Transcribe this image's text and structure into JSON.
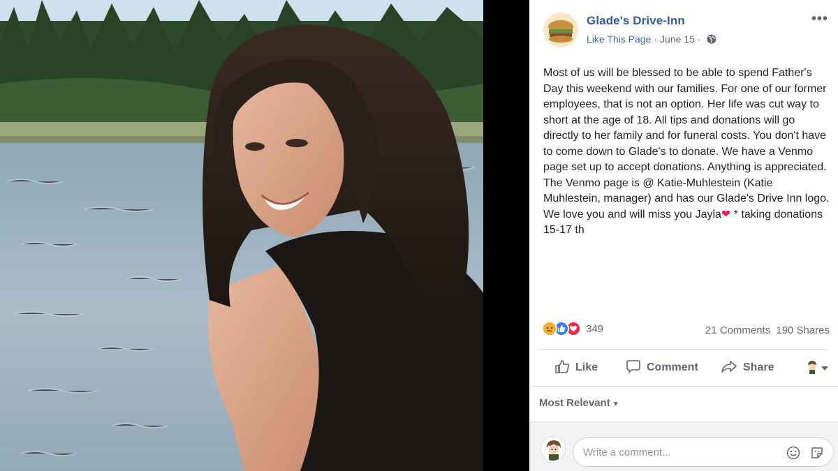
{
  "post": {
    "page_name": "Glade's Drive-Inn",
    "like_page": "Like This Page",
    "date": "June 15",
    "separator": "·",
    "more": "•••",
    "text_parts": [
      "Most of us will be blessed to be able to spend Father's Day this weekend with our families. For one of our former employees, that is not an option. Her life was cut way to short at the age of 18. All tips and donations will go directly to her family and for funeral costs. You don't have to come down to Glade's to donate. We have a Venmo page set up to accept donations. Anything is appreciated. The Venmo page is @ Katie-Muhlestein (Katie Muhlestein, manager) and has our Glade's Drive Inn logo. We love you and will miss you Jayla",
      "❤",
      " * taking donations 15-17 th"
    ]
  },
  "stats": {
    "reaction_count": "349",
    "reactions": [
      "sad",
      "like",
      "love"
    ],
    "comments": "21 Comments",
    "shares": "190 Shares"
  },
  "actions": {
    "like": "Like",
    "comment": "Comment",
    "share": "Share"
  },
  "sort": {
    "label": "Most Relevant",
    "caret": "▼"
  },
  "comment_box": {
    "placeholder": "Write a comment..."
  },
  "colors": {
    "link_blue": "#385898",
    "like_blue": "#3b7bf6",
    "love_red": "#f0284a",
    "sad_yellow": "#f7b125"
  }
}
